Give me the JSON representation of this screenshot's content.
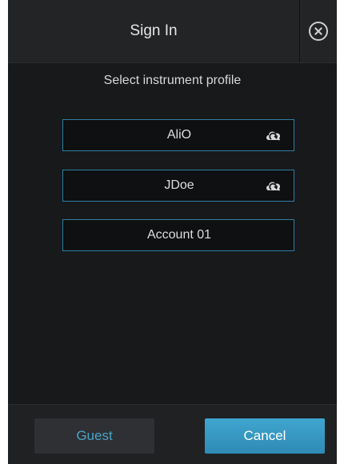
{
  "header": {
    "title": "Sign In",
    "close_icon": "close-circle-icon"
  },
  "subtitle": "Select instrument profile",
  "profiles": [
    {
      "name": "AliO",
      "cloud": true
    },
    {
      "name": "JDoe",
      "cloud": true
    },
    {
      "name": "Account 01",
      "cloud": false
    }
  ],
  "footer": {
    "guest_label": "Guest",
    "cancel_label": "Cancel"
  },
  "colors": {
    "background": "#18191b",
    "accent": "#3a9cc6",
    "border_accent": "#2f7ea3"
  }
}
